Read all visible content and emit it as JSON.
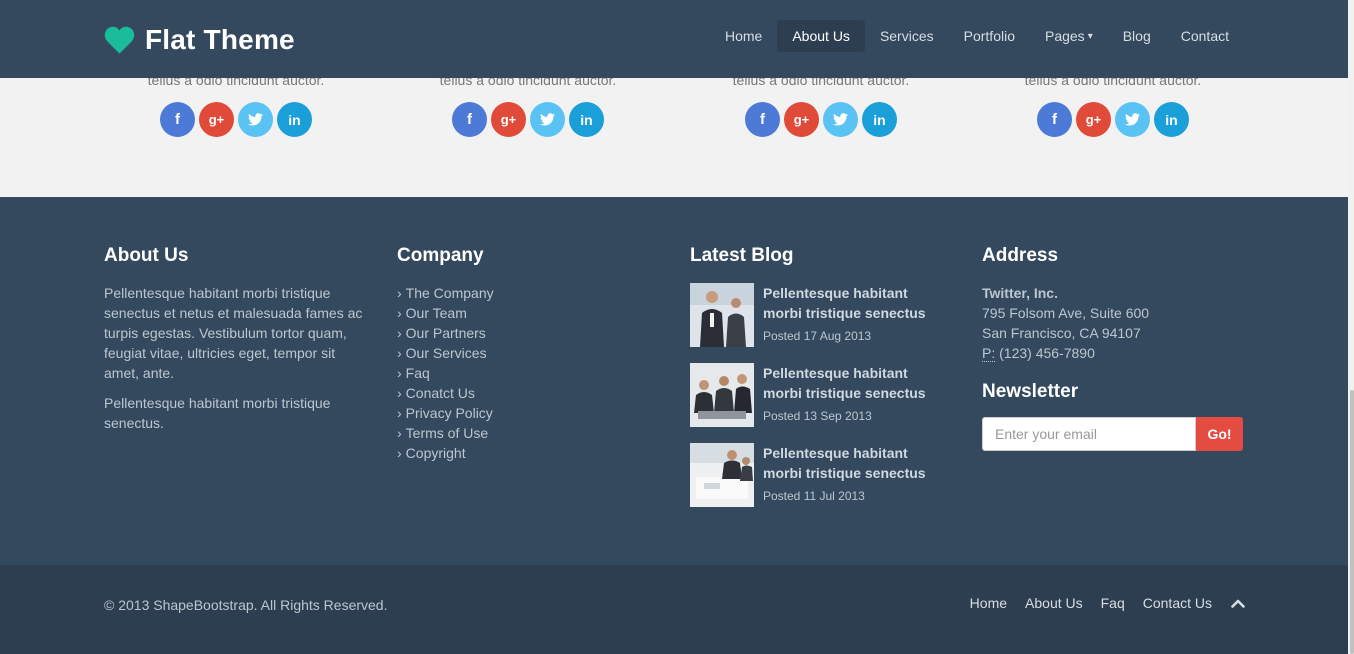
{
  "header": {
    "brand": "Flat Theme",
    "nav": [
      "Home",
      "About Us",
      "Services",
      "Portfolio",
      "Pages",
      "Blog",
      "Contact"
    ],
    "active": "About Us"
  },
  "team": {
    "text": "tellus a odio tincidunt auctor."
  },
  "footer": {
    "about": {
      "title": "About Us",
      "p1": "Pellentesque habitant morbi tristique senectus et netus et malesuada fames ac turpis egestas. Vestibulum tortor quam, feugiat vitae, ultricies eget, tempor sit amet, ante.",
      "p2": "Pellentesque habitant morbi tristique senectus."
    },
    "company": {
      "title": "Company",
      "links": [
        "The Company",
        "Our Team",
        "Our Partners",
        "Our Services",
        "Faq",
        "Conatct Us",
        "Privacy Policy",
        "Terms of Use",
        "Copyright"
      ]
    },
    "blog": {
      "title": "Latest Blog",
      "posts": [
        {
          "title": "Pellentesque habitant morbi tristique senectus",
          "date": "Posted 17 Aug 2013"
        },
        {
          "title": "Pellentesque habitant morbi tristique senectus",
          "date": "Posted 13 Sep 2013"
        },
        {
          "title": "Pellentesque habitant morbi tristique senectus",
          "date": "Posted 11 Jul 2013"
        }
      ]
    },
    "address": {
      "title": "Address",
      "company": "Twitter, Inc.",
      "line1": "795 Folsom Ave, Suite 600",
      "line2": "San Francisco, CA 94107",
      "phone_label": "P:",
      "phone": " (123) 456-7890"
    },
    "newsletter": {
      "title": "Newsletter",
      "placeholder": "Enter your email",
      "button": "Go!"
    }
  },
  "bottom": {
    "copyright": "© 2013 ShapeBootstrap. All Rights Reserved.",
    "links": [
      "Home",
      "About Us",
      "Faq",
      "Contact Us"
    ]
  },
  "colors": {
    "navy": "#34495e",
    "dark_navy": "#2c3e50",
    "accent": "#1abc9c",
    "facebook": "#4e7ad7",
    "google_plus": "#e04a38",
    "twitter": "#5bc3f4",
    "linkedin": "#1a9fd9",
    "go_button": "#e44c41"
  }
}
